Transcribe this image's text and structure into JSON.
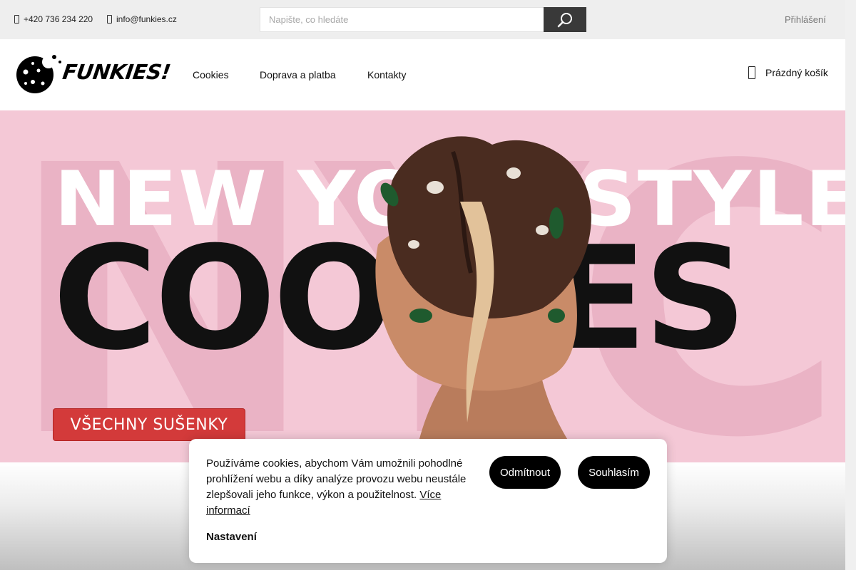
{
  "topbar": {
    "phone": "+420 736 234 220",
    "email": "info@funkies.cz",
    "search_placeholder": "Napište, co hledáte",
    "login": "Přihlášení"
  },
  "header": {
    "logo_text": "FUNKIES!",
    "nav": [
      "Cookies",
      "Doprava a platba",
      "Kontakty"
    ],
    "cart": "Prázdný košík"
  },
  "banner": {
    "line1": "NEW YORK STYLE",
    "line2": "COOKIES",
    "bg_letters": "NYC",
    "cta": "VŠECHNY SUŠENKY",
    "bg_color": "#f4c8d6",
    "cta_color": "#d33a3a"
  },
  "cookie_banner": {
    "text": "Používáme cookies, abychom Vám umožnili pohodlné prohlížení webu a díky analýze provozu webu neustále zlepšovali jeho funkce, výkon a použitelnost.",
    "more_link": "Více informací",
    "settings": "Nastavení",
    "reject": "Odmítnout",
    "accept": "Souhlasím"
  },
  "icons": {
    "phone": "phone-icon",
    "email": "mail-icon",
    "search": "search-icon",
    "cart": "shopping-bag-icon"
  }
}
